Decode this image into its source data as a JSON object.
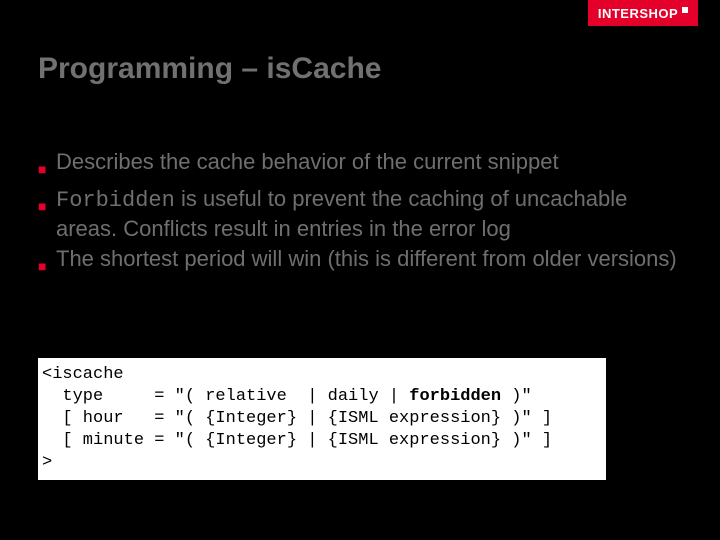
{
  "logo": "INTERSHOP",
  "title": "Programming – isCache",
  "bullets": [
    {
      "pre": "",
      "code": "",
      "post": "Describes the cache behavior of the current snippet"
    },
    {
      "pre": "",
      "code": "Forbidden",
      "post": " is useful to prevent the caching of uncachable areas. Conflicts result in entries in the error log"
    },
    {
      "pre": "",
      "code": "",
      "post": "The shortest period will win (this is different from older versions)"
    }
  ],
  "code": {
    "l1": "<iscache",
    "l2a": "  type     = \"( relative  | daily | ",
    "l2b": "forbidden",
    "l2c": " )\"",
    "l3": "  [ hour   = \"( {Integer} | {ISML expression} )\" ]",
    "l4": "  [ minute = \"( {Integer} | {ISML expression} )\" ]",
    "l5": ">"
  }
}
